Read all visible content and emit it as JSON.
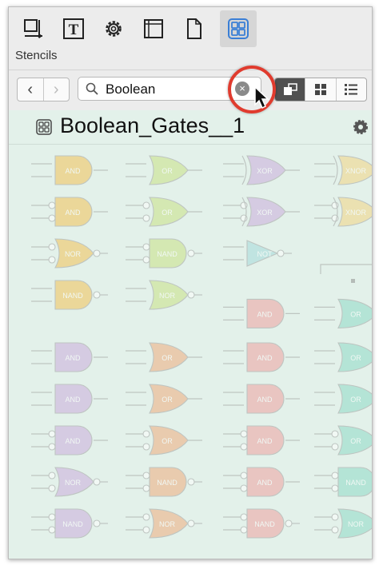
{
  "panel": {
    "section_label": "Stencils"
  },
  "toolbar": {
    "buttons": [
      {
        "icon": "canvas-icon"
      },
      {
        "icon": "text-icon",
        "glyph": "T"
      },
      {
        "icon": "gear-icon"
      },
      {
        "icon": "frame-icon"
      },
      {
        "icon": "document-icon"
      },
      {
        "icon": "stencils-icon",
        "active": true
      }
    ]
  },
  "nav": {
    "back": "‹",
    "forward": "›"
  },
  "search": {
    "value": "Boolean",
    "clear_glyph": "×"
  },
  "stencil": {
    "title": "Boolean_Gates__1"
  },
  "colors": {
    "yellow": "#f3bf4a",
    "green": "#c7e07c",
    "purple": "#c9a6dc",
    "cyan": "#9fd8d9",
    "red": "#ef9a9a",
    "orange": "#f0a673",
    "cyan2": "#86d9c4",
    "grey": "#a8a8a8",
    "highlight": "#e03b2e"
  },
  "gates": [
    {
      "type": "and",
      "label": "AND",
      "color": "#f3bf4a",
      "col": 0,
      "row": 0
    },
    {
      "type": "or",
      "label": "OR",
      "color": "#c7e07c",
      "col": 1,
      "row": 0
    },
    {
      "type": "xor",
      "label": "XOR",
      "color": "#c9a6dc",
      "col": 2,
      "row": 0
    },
    {
      "type": "xnor",
      "label": "XNOR",
      "color": "#f3d27a",
      "col": 3,
      "row": 0
    },
    {
      "type": "and",
      "label": "AND",
      "color": "#f3bf4a",
      "col": 0,
      "row": 1,
      "bubbles": true
    },
    {
      "type": "or",
      "label": "OR",
      "color": "#c7e07c",
      "col": 1,
      "row": 1,
      "bubbles": true
    },
    {
      "type": "xor",
      "label": "XOR",
      "color": "#c9a6dc",
      "col": 2,
      "row": 1,
      "bubbles": true
    },
    {
      "type": "xnor",
      "label": "XNOR",
      "color": "#f3d27a",
      "col": 3,
      "row": 1,
      "bubbles": true
    },
    {
      "type": "nor",
      "label": "NOR",
      "color": "#f3bf4a",
      "col": 0,
      "row": 2,
      "bubbles": true
    },
    {
      "type": "nand",
      "label": "NAND",
      "color": "#c7e07c",
      "col": 1,
      "row": 2,
      "bubbles": true
    },
    {
      "type": "not",
      "label": "NOT",
      "color": "#9fd8d9",
      "col": 2,
      "row": 2
    },
    {
      "type": "nand",
      "label": "NAND",
      "color": "#f3bf4a",
      "col": 0,
      "row": 3
    },
    {
      "type": "nor",
      "label": "NOR",
      "color": "#c7e07c",
      "col": 1,
      "row": 3
    },
    {
      "type": "and",
      "label": "AND",
      "color": "#ef9a9a",
      "col": 2,
      "row": 3.45
    },
    {
      "type": "or",
      "label": "OR",
      "color": "#86d9c4",
      "col": 3,
      "row": 3.45
    },
    {
      "type": "and",
      "label": "AND",
      "color": "#c9a6dc",
      "col": 0,
      "row": 4.5
    },
    {
      "type": "or",
      "label": "OR",
      "color": "#f0a673",
      "col": 1,
      "row": 4.5
    },
    {
      "type": "and",
      "label": "AND",
      "color": "#ef9a9a",
      "col": 2,
      "row": 4.5
    },
    {
      "type": "or",
      "label": "OR",
      "color": "#86d9c4",
      "col": 3,
      "row": 4.5
    },
    {
      "type": "and",
      "label": "AND",
      "color": "#c9a6dc",
      "col": 0,
      "row": 5.5
    },
    {
      "type": "or",
      "label": "OR",
      "color": "#f0a673",
      "col": 1,
      "row": 5.5
    },
    {
      "type": "and",
      "label": "AND",
      "color": "#ef9a9a",
      "col": 2,
      "row": 5.5
    },
    {
      "type": "or",
      "label": "OR",
      "color": "#86d9c4",
      "col": 3,
      "row": 5.5
    },
    {
      "type": "and",
      "label": "AND",
      "color": "#c9a6dc",
      "col": 0,
      "row": 6.5,
      "bubbles": true
    },
    {
      "type": "or",
      "label": "OR",
      "color": "#f0a673",
      "col": 1,
      "row": 6.5,
      "bubbles": true
    },
    {
      "type": "and",
      "label": "AND",
      "color": "#ef9a9a",
      "col": 2,
      "row": 6.5,
      "bubbles": true
    },
    {
      "type": "or",
      "label": "OR",
      "color": "#86d9c4",
      "col": 3,
      "row": 6.5,
      "bubbles": true
    },
    {
      "type": "nor",
      "label": "NOR",
      "color": "#c9a6dc",
      "col": 0,
      "row": 7.5,
      "bubbles": true
    },
    {
      "type": "nand",
      "label": "NAND",
      "color": "#f0a673",
      "col": 1,
      "row": 7.5,
      "bubbles": true
    },
    {
      "type": "and",
      "label": "AND",
      "color": "#ef9a9a",
      "col": 2,
      "row": 7.5,
      "bubbles": true
    },
    {
      "type": "nand",
      "label": "NAND",
      "color": "#86d9c4",
      "col": 3,
      "row": 7.5,
      "bubbles": true
    },
    {
      "type": "nand",
      "label": "NAND",
      "color": "#c9a6dc",
      "col": 0,
      "row": 8.5,
      "bubbles": true
    },
    {
      "type": "nor",
      "label": "NOR",
      "color": "#f0a673",
      "col": 1,
      "row": 8.5,
      "bubbles": true
    },
    {
      "type": "nand",
      "label": "NAND",
      "color": "#ef9a9a",
      "col": 2,
      "row": 8.5,
      "bubbles": true
    },
    {
      "type": "nor",
      "label": "NOR",
      "color": "#86d9c4",
      "col": 3,
      "row": 8.5,
      "bubbles": true
    }
  ]
}
